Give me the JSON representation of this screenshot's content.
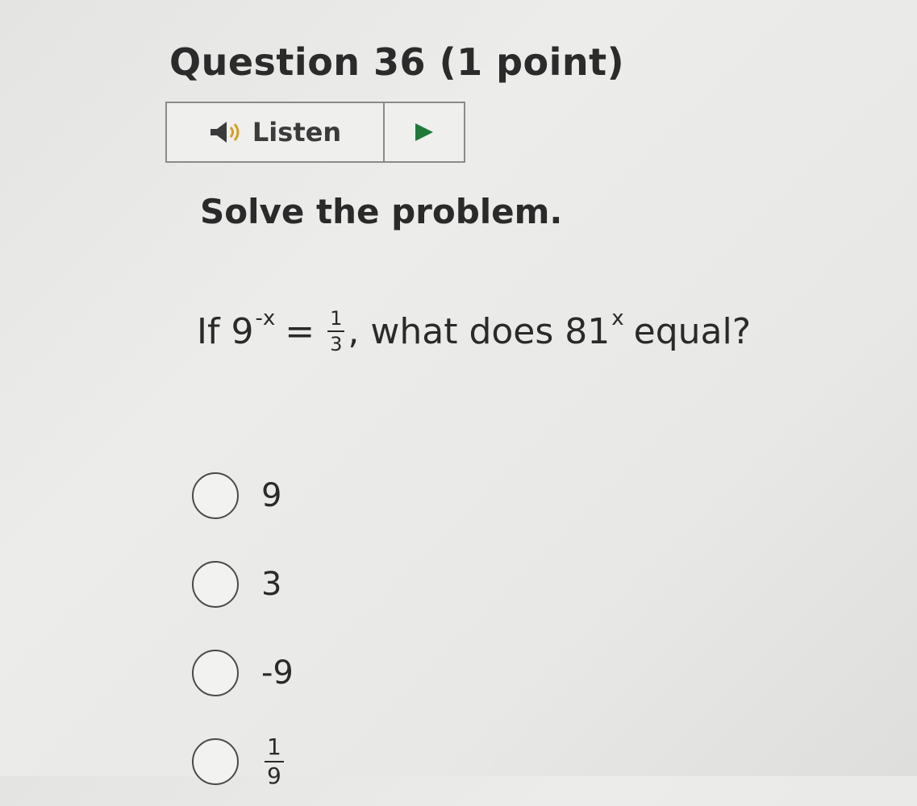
{
  "question": {
    "title": "Question 36 (1 point)"
  },
  "listen": {
    "label": "Listen",
    "speaker_icon": "speaker-icon",
    "play_icon": "play-icon"
  },
  "instruction": "Solve the problem.",
  "problem": {
    "prefix": "If 9",
    "exponent1": "-x",
    "equals": "=",
    "fraction": {
      "num": "1",
      "den": "3"
    },
    "middle": ", what does 81",
    "exponent2": "x",
    "suffix": "equal?"
  },
  "options": [
    {
      "label": "9"
    },
    {
      "label": "3"
    },
    {
      "label": "-9"
    },
    {
      "num": "1",
      "den": "9"
    }
  ],
  "colors": {
    "play": "#1f7a3a",
    "text": "#2a2a2a",
    "border": "#8a8a8a"
  }
}
